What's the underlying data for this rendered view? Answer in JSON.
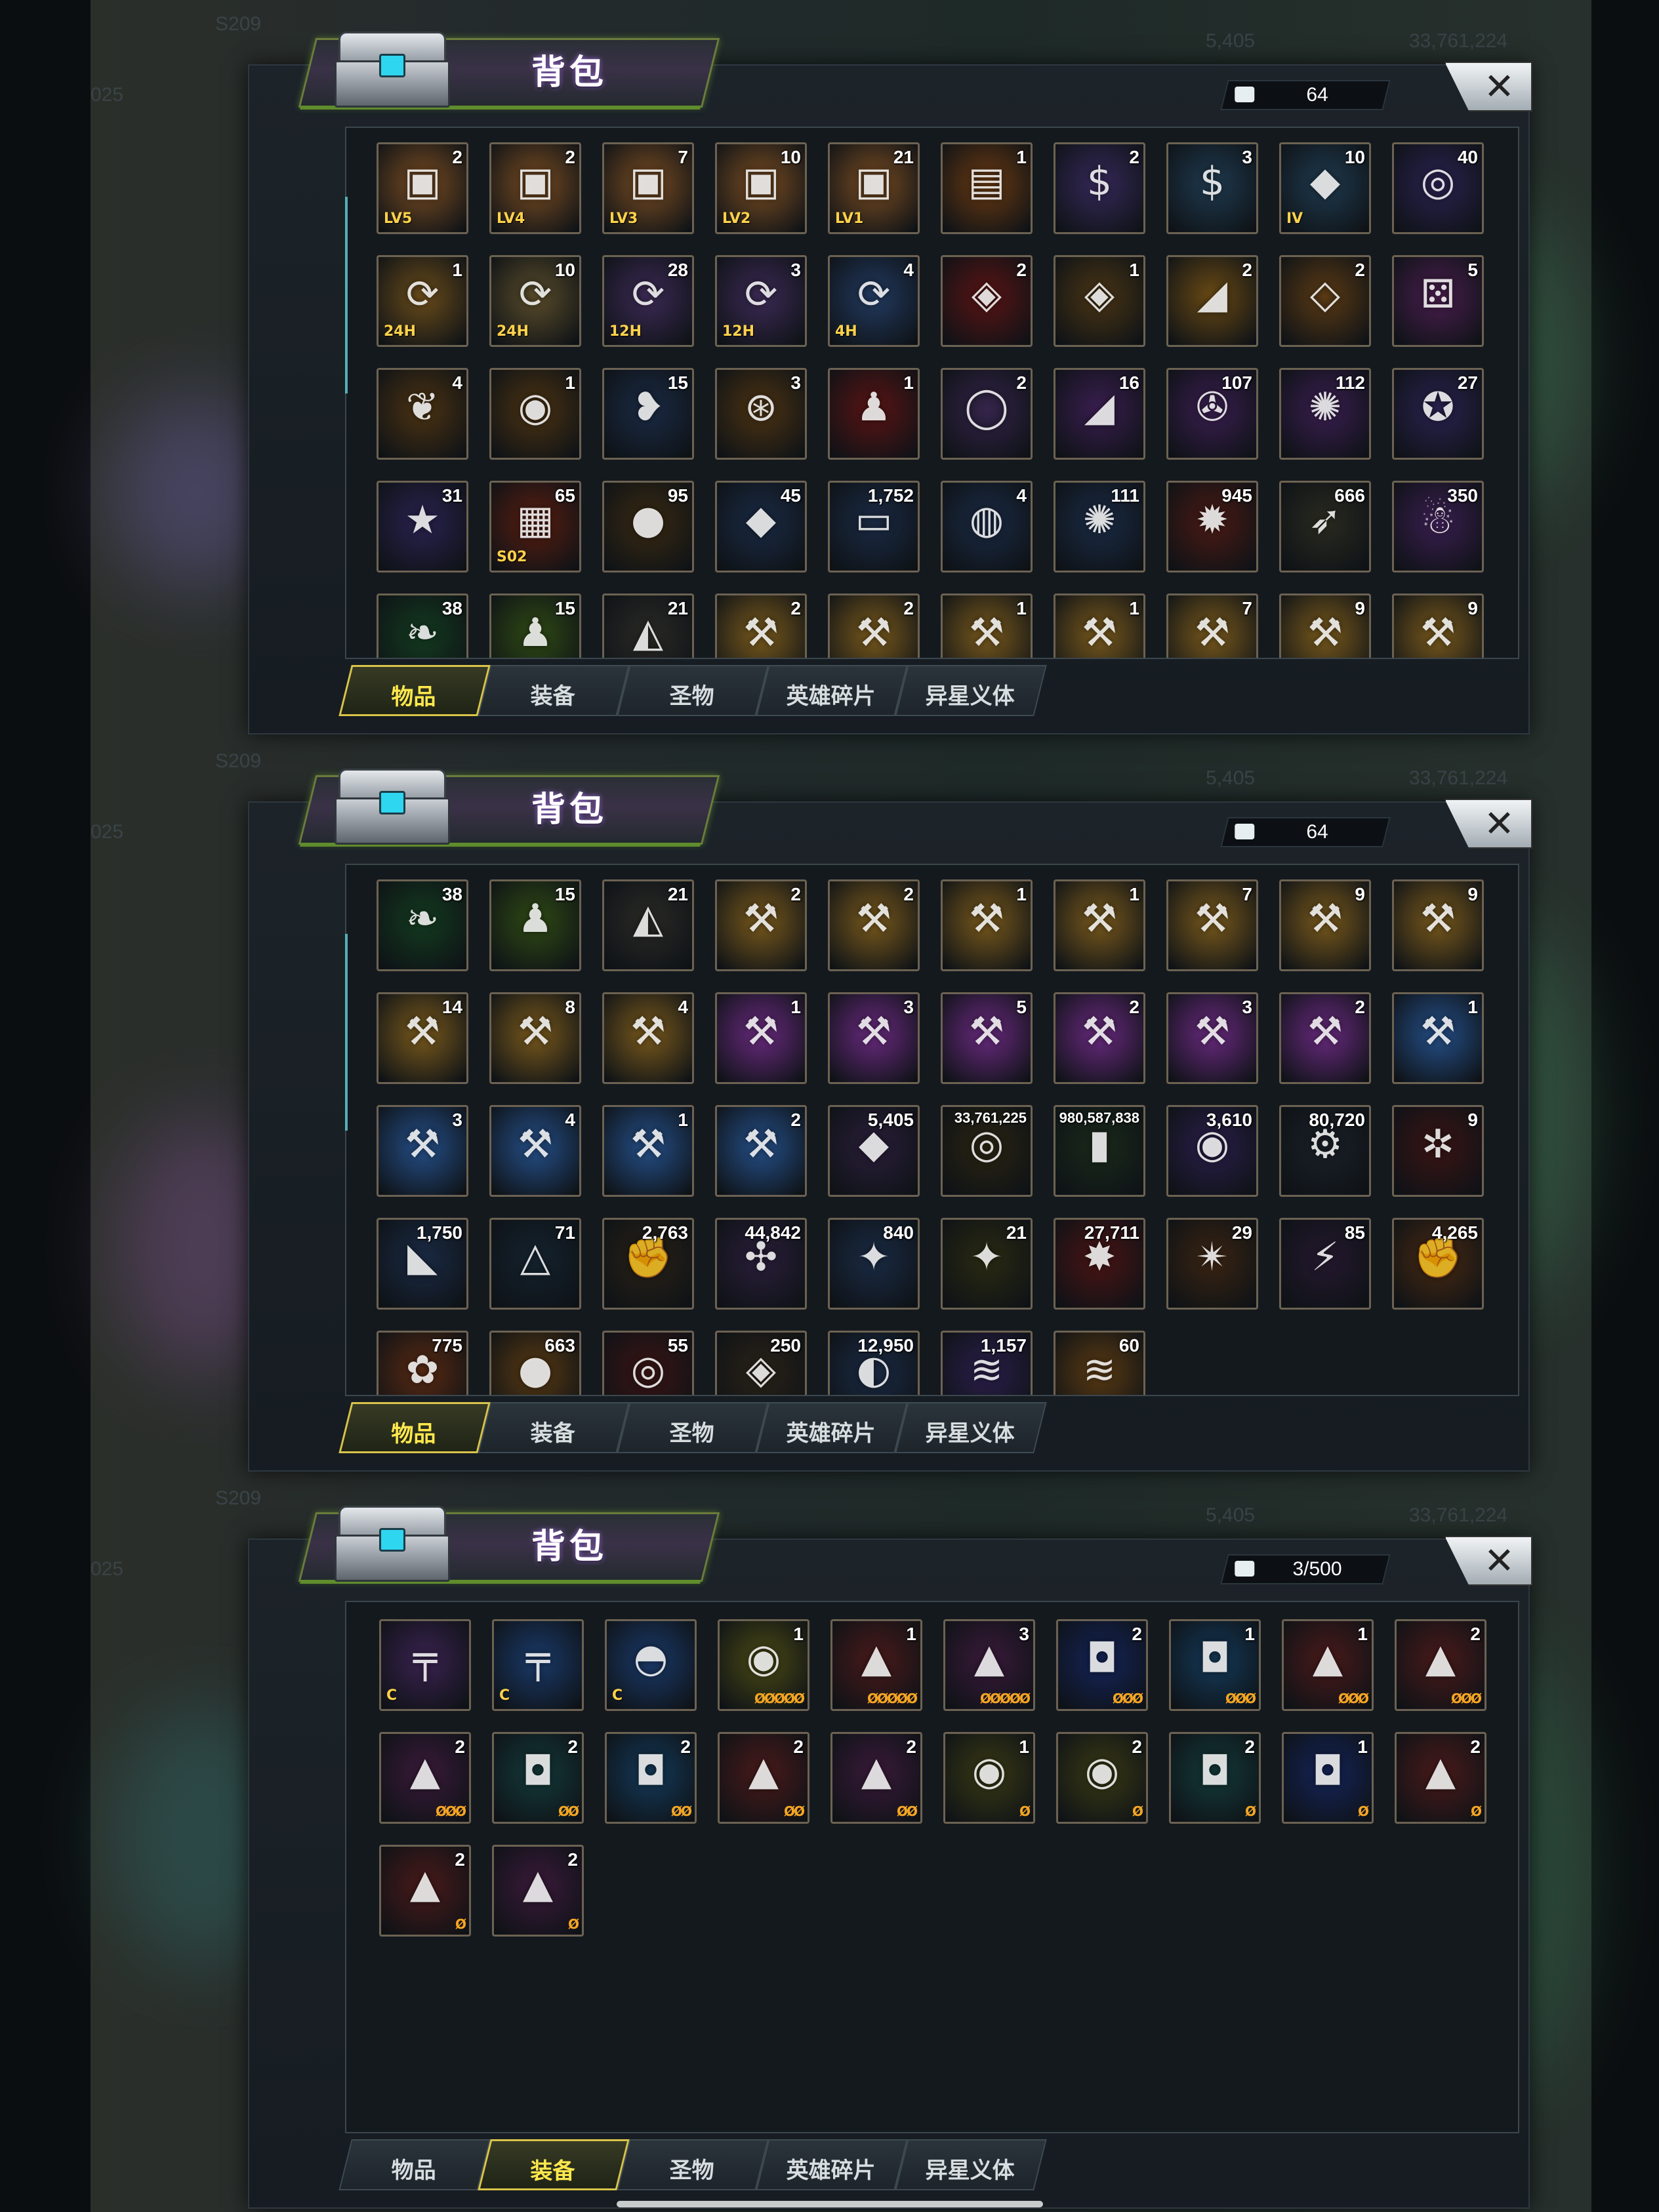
{
  "screens": [
    {
      "title": "背包",
      "counter": "64",
      "close": "✕",
      "ghost_left": "S209",
      "ghost_res1": "5,405",
      "ghost_res2": "33,761,224",
      "ghost_side": "025",
      "active_tab": 0,
      "tabs": [
        "物品",
        "装备",
        "圣物",
        "英雄碎片",
        "异星义体"
      ],
      "items": [
        {
          "qty": "2",
          "tag": "LV5",
          "color": "#7a4d22",
          "icon": "chest-icon"
        },
        {
          "qty": "2",
          "tag": "LV4",
          "color": "#7a4d22",
          "icon": "chest-icon"
        },
        {
          "qty": "7",
          "tag": "LV3",
          "color": "#7a4d22",
          "icon": "chest-icon"
        },
        {
          "qty": "10",
          "tag": "LV2",
          "color": "#7a4d22",
          "icon": "chest-icon"
        },
        {
          "qty": "21",
          "tag": "LV1",
          "color": "#7a4d22",
          "icon": "chest-icon"
        },
        {
          "qty": "1",
          "tag": "",
          "color": "#6b3a12",
          "icon": "wooden-chest-icon"
        },
        {
          "qty": "2",
          "tag": "",
          "color": "#36295a",
          "icon": "cash-case-icon"
        },
        {
          "qty": "3",
          "tag": "",
          "color": "#1f3a4f",
          "icon": "cash-case-icon"
        },
        {
          "qty": "10",
          "tag": "IV",
          "color": "#1f3a4f",
          "icon": "crystal-case-icon"
        },
        {
          "qty": "40",
          "tag": "",
          "color": "#2a2250",
          "icon": "device-icon"
        },
        {
          "qty": "1",
          "tag": "24H",
          "color": "#6a4c1a",
          "icon": "speedup-icon"
        },
        {
          "qty": "10",
          "tag": "24H",
          "color": "#5a4c2a",
          "icon": "speedup-icon"
        },
        {
          "qty": "28",
          "tag": "12H",
          "color": "#3c2a55",
          "icon": "speedup-icon"
        },
        {
          "qty": "3",
          "tag": "12H",
          "color": "#3c2a55",
          "icon": "speedup-icon"
        },
        {
          "qty": "4",
          "tag": "4H",
          "color": "#223a60",
          "icon": "speedup-icon"
        },
        {
          "qty": "2",
          "tag": "",
          "color": "#5a1414",
          "icon": "cube-icon"
        },
        {
          "qty": "1",
          "tag": "",
          "color": "#4a3514",
          "icon": "cube-icon"
        },
        {
          "qty": "2",
          "tag": "",
          "color": "#6a4a14",
          "icon": "shard-icon"
        },
        {
          "qty": "2",
          "tag": "",
          "color": "#5a3a14",
          "icon": "gem-icon"
        },
        {
          "qty": "5",
          "tag": "",
          "color": "#4a1e4f",
          "icon": "dice-icon"
        },
        {
          "qty": "4",
          "tag": "",
          "color": "#4c3312",
          "icon": "plant-icon"
        },
        {
          "qty": "1",
          "tag": "",
          "color": "#4c3312",
          "icon": "core-icon"
        },
        {
          "qty": "15",
          "tag": "",
          "color": "#1a2a44",
          "icon": "lips-icon"
        },
        {
          "qty": "3",
          "tag": "",
          "color": "#4c3312",
          "icon": "orbit-icon"
        },
        {
          "qty": "1",
          "tag": "",
          "color": "#5a1414",
          "icon": "bowling-icon"
        },
        {
          "qty": "2",
          "tag": "",
          "color": "#34244a",
          "icon": "ring-icon"
        },
        {
          "qty": "16",
          "tag": "",
          "color": "#3a1e50",
          "icon": "shard-icon"
        },
        {
          "qty": "107",
          "tag": "",
          "color": "#3a1e50",
          "icon": "film-icon"
        },
        {
          "qty": "112",
          "tag": "",
          "color": "#3a1e50",
          "icon": "cap-icon"
        },
        {
          "qty": "27",
          "tag": "",
          "color": "#2a2250",
          "icon": "chip-icon"
        },
        {
          "qty": "31",
          "tag": "",
          "color": "#2a2250",
          "icon": "badge-icon"
        },
        {
          "qty": "65",
          "tag": "S02",
          "color": "#5a1e10",
          "icon": "ticket-icon"
        },
        {
          "qty": "95",
          "tag": "",
          "color": "#3a2a12",
          "icon": "berry-icon"
        },
        {
          "qty": "45",
          "tag": "",
          "color": "#1a2a44",
          "icon": "crystal-icon"
        },
        {
          "qty": "1,752",
          "tag": "",
          "color": "#1a2a44",
          "icon": "cinema-ticket-icon"
        },
        {
          "qty": "4",
          "tag": "",
          "color": "#1a2a44",
          "icon": "token-icon"
        },
        {
          "qty": "111",
          "tag": "",
          "color": "#1a2a44",
          "icon": "cap-icon"
        },
        {
          "qty": "945",
          "tag": "",
          "color": "#4a1a14",
          "icon": "poker-chip-icon"
        },
        {
          "qty": "666",
          "tag": "",
          "color": "#2a2a20",
          "icon": "bullet-icon"
        },
        {
          "qty": "350",
          "tag": "",
          "color": "#3a1e50",
          "icon": "gingerbread-icon"
        },
        {
          "qty": "38",
          "tag": "",
          "color": "#133a1f",
          "icon": "leaf-icon"
        },
        {
          "qty": "15",
          "tag": "",
          "color": "#2f4a14",
          "icon": "bowling-icon"
        },
        {
          "qty": "21",
          "tag": "",
          "color": "#2a2a26",
          "icon": "stone-icon"
        },
        {
          "qty": "2",
          "tag": "",
          "color": "#7a5a1c",
          "icon": "blueprint-icon"
        },
        {
          "qty": "2",
          "tag": "",
          "color": "#7a5a1c",
          "icon": "blueprint-icon"
        },
        {
          "qty": "1",
          "tag": "",
          "color": "#7a5a1c",
          "icon": "blueprint-icon"
        },
        {
          "qty": "1",
          "tag": "",
          "color": "#7a5a1c",
          "icon": "blueprint-icon"
        },
        {
          "qty": "7",
          "tag": "",
          "color": "#7a5a1c",
          "icon": "blueprint-icon"
        },
        {
          "qty": "9",
          "tag": "",
          "color": "#7a5a1c",
          "icon": "blueprint-icon"
        },
        {
          "qty": "9",
          "tag": "",
          "color": "#7a5a1c",
          "icon": "blueprint-icon"
        }
      ]
    },
    {
      "title": "背包",
      "counter": "64",
      "close": "✕",
      "ghost_left": "S209",
      "ghost_res1": "5,405",
      "ghost_res2": "33,761,224",
      "ghost_side": "025",
      "active_tab": 0,
      "tabs": [
        "物品",
        "装备",
        "圣物",
        "英雄碎片",
        "异星义体"
      ],
      "items": [
        {
          "qty": "38",
          "tag": "",
          "color": "#133a1f",
          "icon": "leaf-icon"
        },
        {
          "qty": "15",
          "tag": "",
          "color": "#2f4a14",
          "icon": "bowling-icon"
        },
        {
          "qty": "21",
          "tag": "",
          "color": "#2a2a26",
          "icon": "stone-icon"
        },
        {
          "qty": "2",
          "tag": "",
          "color": "#7a5a1c",
          "icon": "blueprint-icon"
        },
        {
          "qty": "2",
          "tag": "",
          "color": "#7a5a1c",
          "icon": "blueprint-icon"
        },
        {
          "qty": "1",
          "tag": "",
          "color": "#7a5a1c",
          "icon": "blueprint-icon"
        },
        {
          "qty": "1",
          "tag": "",
          "color": "#7a5a1c",
          "icon": "blueprint-icon"
        },
        {
          "qty": "7",
          "tag": "",
          "color": "#7a5a1c",
          "icon": "blueprint-icon"
        },
        {
          "qty": "9",
          "tag": "",
          "color": "#7a5a1c",
          "icon": "blueprint-icon"
        },
        {
          "qty": "9",
          "tag": "",
          "color": "#7a5a1c",
          "icon": "blueprint-icon"
        },
        {
          "qty": "14",
          "tag": "",
          "color": "#7a5a1c",
          "icon": "blueprint-icon"
        },
        {
          "qty": "8",
          "tag": "",
          "color": "#7a5a1c",
          "icon": "blueprint-icon"
        },
        {
          "qty": "4",
          "tag": "",
          "color": "#7a5a1c",
          "icon": "blueprint-icon"
        },
        {
          "qty": "1",
          "tag": "",
          "color": "#6a2a80",
          "icon": "blueprint-icon"
        },
        {
          "qty": "3",
          "tag": "",
          "color": "#6a2a80",
          "icon": "blueprint-icon"
        },
        {
          "qty": "5",
          "tag": "",
          "color": "#6a2a80",
          "icon": "blueprint-icon"
        },
        {
          "qty": "2",
          "tag": "",
          "color": "#6a2a80",
          "icon": "blueprint-icon"
        },
        {
          "qty": "3",
          "tag": "",
          "color": "#6a2a80",
          "icon": "blueprint-icon"
        },
        {
          "qty": "2",
          "tag": "",
          "color": "#6a2a80",
          "icon": "blueprint-icon"
        },
        {
          "qty": "1",
          "tag": "",
          "color": "#25508a",
          "icon": "blueprint-icon"
        },
        {
          "qty": "3",
          "tag": "",
          "color": "#25508a",
          "icon": "blueprint-icon"
        },
        {
          "qty": "4",
          "tag": "",
          "color": "#25508a",
          "icon": "blueprint-icon"
        },
        {
          "qty": "1",
          "tag": "",
          "color": "#25508a",
          "icon": "blueprint-icon"
        },
        {
          "qty": "2",
          "tag": "",
          "color": "#25508a",
          "icon": "blueprint-icon"
        },
        {
          "qty": "5,405",
          "tag": "",
          "color": "#2a1e3a",
          "icon": "purple-gem-icon"
        },
        {
          "qty": "33,761,225",
          "tag": "",
          "color": "#2a2412",
          "icon": "coins-icon"
        },
        {
          "qty": "980,587,838",
          "tag": "",
          "color": "#1a2a1a",
          "icon": "battery-icon"
        },
        {
          "qty": "3,610",
          "tag": "",
          "color": "#2a1e4a",
          "icon": "orb-icon"
        },
        {
          "qty": "80,720",
          "tag": "",
          "color": "#1a2028",
          "icon": "gear-icon"
        },
        {
          "qty": "9",
          "tag": "",
          "color": "#3a1414",
          "icon": "network-icon"
        },
        {
          "qty": "1,750",
          "tag": "",
          "color": "#1a2a44",
          "icon": "wolf-icon"
        },
        {
          "qty": "71",
          "tag": "",
          "color": "#14222e",
          "icon": "triangle-icon"
        },
        {
          "qty": "2,763",
          "tag": "",
          "color": "#2a2218",
          "icon": "fist-icon"
        },
        {
          "qty": "44,842",
          "tag": "",
          "color": "#2a1e3a",
          "icon": "puzzle-icon"
        },
        {
          "qty": "840",
          "tag": "",
          "color": "#1a2a44",
          "icon": "medal-icon"
        },
        {
          "qty": "21",
          "tag": "",
          "color": "#2a2a12",
          "icon": "medal-icon"
        },
        {
          "qty": "27,711",
          "tag": "",
          "color": "#4a1414",
          "icon": "spark-icon"
        },
        {
          "qty": "29",
          "tag": "",
          "color": "#3a2412",
          "icon": "star-burst-icon"
        },
        {
          "qty": "85",
          "tag": "",
          "color": "#24182e",
          "icon": "lightning-icon"
        },
        {
          "qty": "4,265",
          "tag": "",
          "color": "#4a2a12",
          "icon": "gold-fist-icon"
        },
        {
          "qty": "775",
          "tag": "",
          "color": "#5a2a12",
          "icon": "flower-icon"
        },
        {
          "qty": "663",
          "tag": "",
          "color": "#5a3a12",
          "icon": "coin-icon"
        },
        {
          "qty": "55",
          "tag": "",
          "color": "#3a1414",
          "icon": "target-icon"
        },
        {
          "qty": "250",
          "tag": "",
          "color": "#2a2218",
          "icon": "gold-pile-icon"
        },
        {
          "qty": "12,950",
          "tag": "",
          "color": "#1a2a44",
          "icon": "silver-icon"
        },
        {
          "qty": "1,157",
          "tag": "",
          "color": "#2a1e4a",
          "icon": "dna-icon"
        },
        {
          "qty": "60",
          "tag": "",
          "color": "#5a3a12",
          "icon": "gold-dna-icon"
        }
      ]
    },
    {
      "title": "背包",
      "counter": "3/500",
      "close": "✕",
      "ghost_left": "S209",
      "ghost_res1": "5,405",
      "ghost_res2": "33,761,224",
      "ghost_side": "025",
      "active_tab": 1,
      "tabs": [
        "物品",
        "装备",
        "圣物",
        "英雄碎片",
        "异星义体"
      ],
      "items": [
        {
          "qty": "",
          "tag": "C",
          "stars": "",
          "color": "#3a2250",
          "icon": "rifle-icon"
        },
        {
          "qty": "",
          "tag": "C",
          "stars": "",
          "color": "#1a3a6a",
          "icon": "rifle-icon"
        },
        {
          "qty": "",
          "tag": "C",
          "stars": "",
          "color": "#1a3a6a",
          "icon": "helmet-icon"
        },
        {
          "qty": "1",
          "tag": "",
          "stars": "ØØØØØ",
          "color": "#4a4a14",
          "icon": "disc-module-icon"
        },
        {
          "qty": "1",
          "tag": "",
          "stars": "ØØØØØ",
          "color": "#4a1a1a",
          "icon": "prism-module-icon"
        },
        {
          "qty": "3",
          "tag": "",
          "stars": "ØØØØØ",
          "color": "#3a1a3a",
          "icon": "prism-module-icon"
        },
        {
          "qty": "2",
          "tag": "",
          "stars": "ØØØ",
          "color": "#14245a",
          "icon": "cube-module-icon"
        },
        {
          "qty": "1",
          "tag": "",
          "stars": "ØØØ",
          "color": "#143a5a",
          "icon": "cube-module-icon"
        },
        {
          "qty": "1",
          "tag": "",
          "stars": "ØØØ",
          "color": "#4a1a1a",
          "icon": "prism-module-icon"
        },
        {
          "qty": "2",
          "tag": "",
          "stars": "ØØØ",
          "color": "#4a1a1a",
          "icon": "prism-module-icon"
        },
        {
          "qty": "2",
          "tag": "",
          "stars": "ØØØ",
          "color": "#3a1a3a",
          "icon": "prism-module-icon"
        },
        {
          "qty": "2",
          "tag": "",
          "stars": "ØØ",
          "color": "#143a3a",
          "icon": "cube-module-icon"
        },
        {
          "qty": "2",
          "tag": "",
          "stars": "ØØ",
          "color": "#143a5a",
          "icon": "cube-module-icon"
        },
        {
          "qty": "2",
          "tag": "",
          "stars": "ØØ",
          "color": "#4a1a1a",
          "icon": "prism-module-icon"
        },
        {
          "qty": "2",
          "tag": "",
          "stars": "ØØ",
          "color": "#3a1a3a",
          "icon": "prism-module-icon"
        },
        {
          "qty": "1",
          "tag": "",
          "stars": "Ø",
          "color": "#3a3a14",
          "icon": "disc-module-icon"
        },
        {
          "qty": "2",
          "tag": "",
          "stars": "Ø",
          "color": "#3a3a14",
          "icon": "disc-module-icon"
        },
        {
          "qty": "2",
          "tag": "",
          "stars": "Ø",
          "color": "#143a3a",
          "icon": "cube-module-icon"
        },
        {
          "qty": "1",
          "tag": "",
          "stars": "Ø",
          "color": "#14245a",
          "icon": "cube-module-icon"
        },
        {
          "qty": "2",
          "tag": "",
          "stars": "Ø",
          "color": "#4a1a1a",
          "icon": "prism-module-icon"
        },
        {
          "qty": "2",
          "tag": "",
          "stars": "Ø",
          "color": "#4a1a1a",
          "icon": "prism-module-icon"
        },
        {
          "qty": "2",
          "tag": "",
          "stars": "Ø",
          "color": "#3a1a3a",
          "icon": "prism-module-icon"
        }
      ]
    }
  ],
  "icon_glyphs": {
    "chest-icon": "▣",
    "wooden-chest-icon": "▤",
    "cash-case-icon": "$",
    "crystal-case-icon": "◆",
    "device-icon": "◎",
    "speedup-icon": "⟳",
    "cube-icon": "◈",
    "shard-icon": "◢",
    "gem-icon": "◇",
    "dice-icon": "⚄",
    "plant-icon": "❦",
    "core-icon": "◉",
    "lips-icon": "❥",
    "orbit-icon": "⊛",
    "bowling-icon": "♟",
    "ring-icon": "◯",
    "film-icon": "✇",
    "cap-icon": "✺",
    "chip-icon": "✪",
    "badge-icon": "★",
    "ticket-icon": "▦",
    "berry-icon": "●",
    "crystal-icon": "◆",
    "cinema-ticket-icon": "▭",
    "token-icon": "◍",
    "poker-chip-icon": "✹",
    "bullet-icon": "➶",
    "gingerbread-icon": "☃",
    "leaf-icon": "❧",
    "stone-icon": "◭",
    "blueprint-icon": "⚒",
    "purple-gem-icon": "◆",
    "coins-icon": "◎",
    "battery-icon": "▮",
    "orb-icon": "◉",
    "gear-icon": "⚙",
    "network-icon": "✲",
    "wolf-icon": "◣",
    "triangle-icon": "△",
    "fist-icon": "✊",
    "puzzle-icon": "✣",
    "medal-icon": "✦",
    "spark-icon": "✸",
    "star-burst-icon": "✴",
    "lightning-icon": "⚡",
    "gold-fist-icon": "✊",
    "flower-icon": "✿",
    "coin-icon": "●",
    "target-icon": "◎",
    "gold-pile-icon": "◈",
    "silver-icon": "◐",
    "dna-icon": "≋",
    "gold-dna-icon": "≋",
    "rifle-icon": "╤",
    "helmet-icon": "◓",
    "disc-module-icon": "◉",
    "prism-module-icon": "▲",
    "cube-module-icon": "◘"
  }
}
